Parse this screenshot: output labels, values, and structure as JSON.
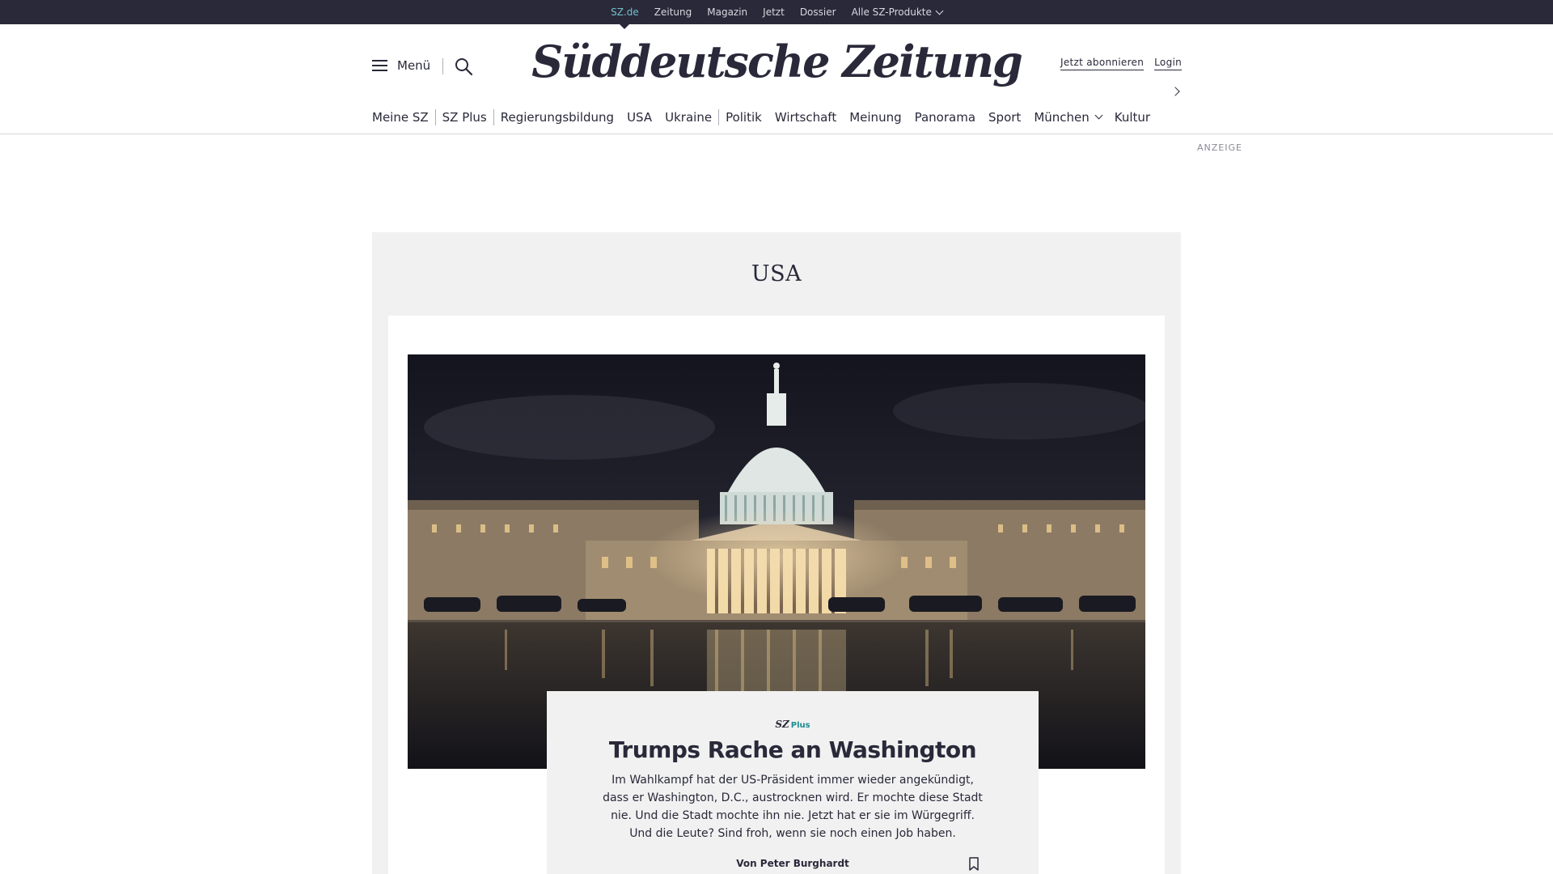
{
  "topbar": {
    "items": [
      "SZ.de",
      "Zeitung",
      "Magazin",
      "Jetzt",
      "Dossier",
      "Alle SZ-Produkte"
    ]
  },
  "header": {
    "menu_label": "Menü",
    "logo": "Süddeutsche Zeitung",
    "subscribe": "Jetzt abonnieren",
    "login": "Login"
  },
  "nav": {
    "items": [
      "Meine SZ",
      "SZ Plus",
      "Regierungsbildung",
      "USA",
      "Ukraine",
      "Politik",
      "Wirtschaft",
      "Meinung",
      "Panorama",
      "Sport",
      "München",
      "Kultur"
    ]
  },
  "ad_label": "ANZEIGE",
  "section": {
    "title": "USA",
    "teaser": {
      "badge_sz": "SZ",
      "badge_plus": "Plus",
      "headline": "Trumps Rache an Washington",
      "text": "Im Wahlkampf hat der US-Präsident immer wieder angekündigt, dass er Washington, D.C., austrocknen wird. Er mochte diese Stadt nie. Und die Stadt mochte ihn nie. Jetzt hat er sie im Würgegriff. Und die Leute? Sind froh, wenn sie noch einen Job haben.",
      "author": "Von Peter Burghardt"
    }
  },
  "colors": {
    "topbar_bg": "#29293a",
    "accent": "#71c1c8",
    "plus": "#1a8c94",
    "section_bg": "#f1f1f1"
  },
  "icons": [
    "hamburger-icon",
    "search-icon",
    "chevron-down-icon",
    "chevron-right-icon",
    "bookmark-icon"
  ]
}
